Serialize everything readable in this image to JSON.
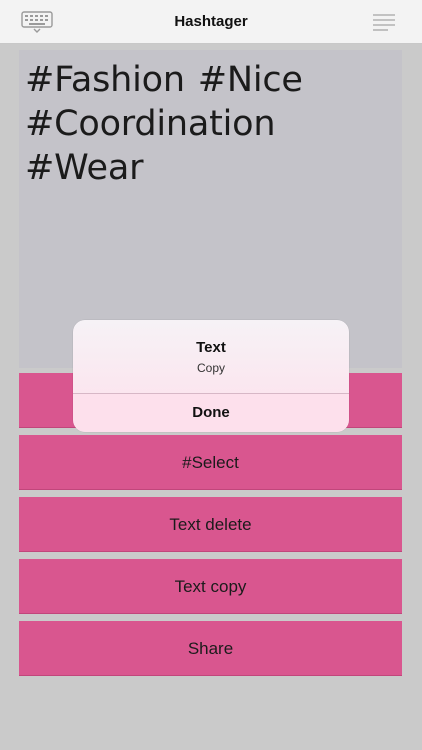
{
  "header": {
    "title": "Hashtager",
    "left_icon": "keyboard-icon",
    "right_icon": "menu-lines-icon"
  },
  "editor": {
    "text": "#Fashion #Nice #Coordination #Wear"
  },
  "actions": {
    "select_label": "#Select",
    "delete_label": "Text delete",
    "copy_label": "Text copy",
    "share_label": "Share"
  },
  "alert": {
    "title": "Text",
    "message": "Copy",
    "done_label": "Done"
  },
  "colors": {
    "accent": "#d9568f",
    "text_area": "#c4c3c9",
    "background": "#cacaca"
  }
}
